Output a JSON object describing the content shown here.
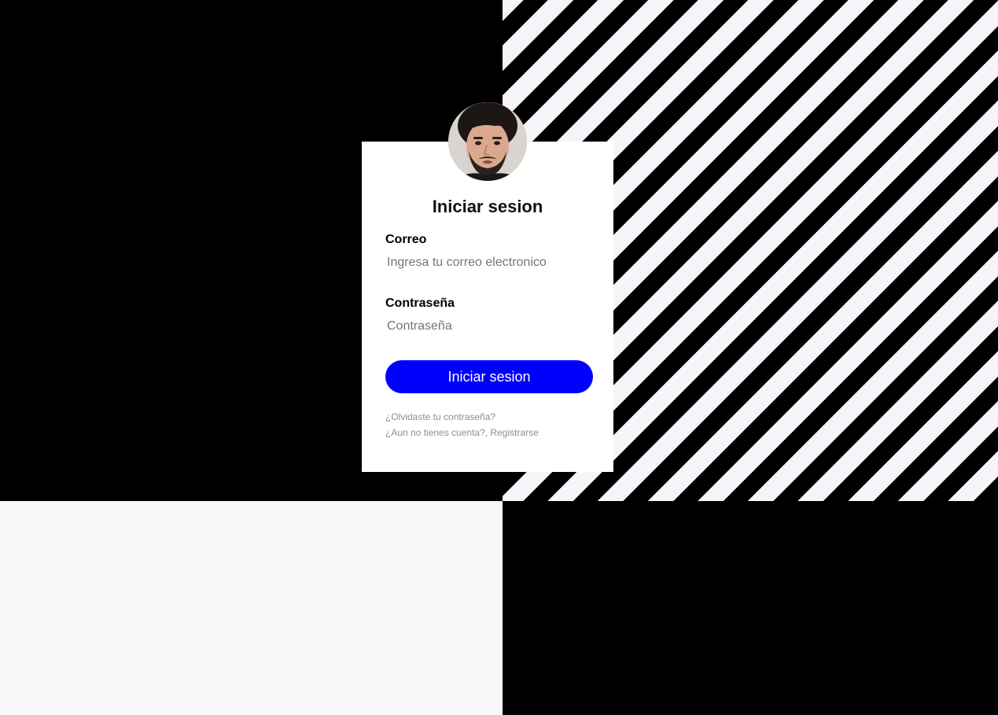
{
  "login": {
    "title": "Iniciar sesion",
    "email_label": "Correo",
    "email_placeholder": "Ingresa tu correo electronico",
    "password_label": "Contraseña",
    "password_placeholder": "Contraseña",
    "submit_label": "Iniciar sesion",
    "forgot_link": "¿Olvidaste tu contraseña?",
    "register_link": "¿Aun no tienes cuenta?, Registrarse"
  },
  "colors": {
    "button_bg": "#0000ff",
    "background_dark": "#000000",
    "background_light": "#f8f7f9",
    "link_text": "#8e8e8e"
  },
  "icons": {
    "avatar": "user-avatar-photo"
  }
}
